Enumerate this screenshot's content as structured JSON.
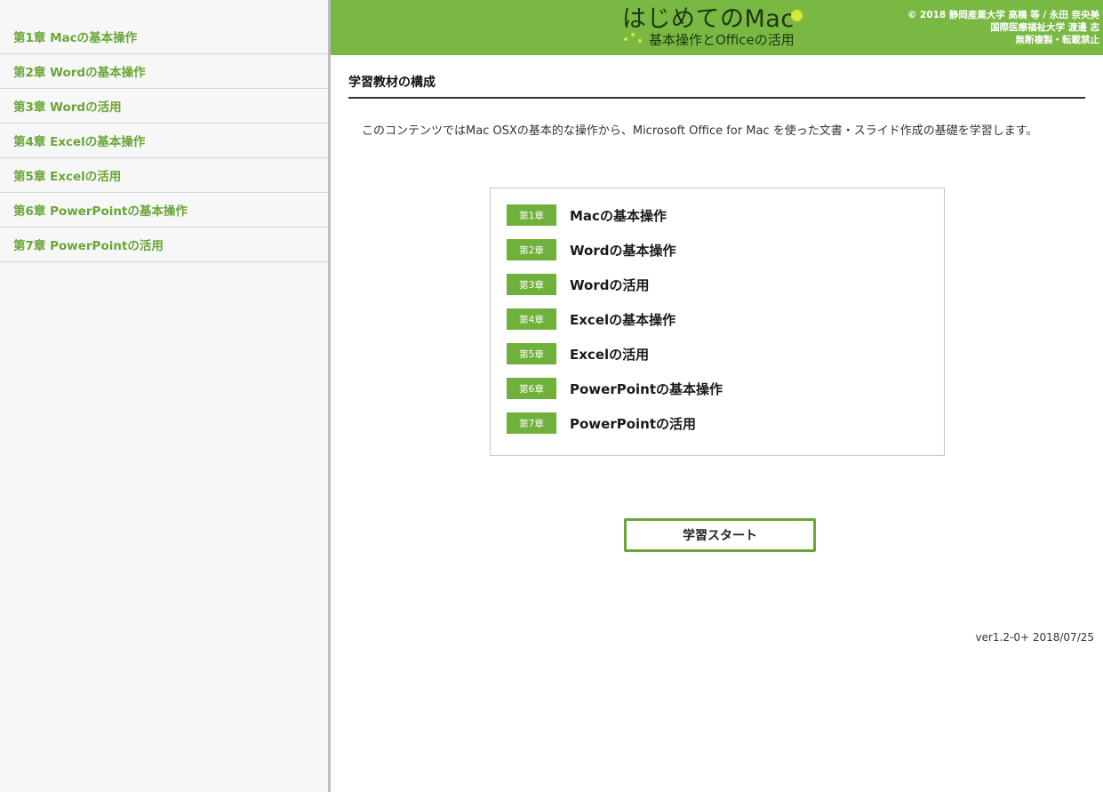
{
  "sidebar": {
    "items": [
      {
        "label": "第1章 Macの基本操作"
      },
      {
        "label": "第2章 Wordの基本操作"
      },
      {
        "label": "第3章 Wordの活用"
      },
      {
        "label": "第4章 Excelの基本操作"
      },
      {
        "label": "第5章 Excelの活用"
      },
      {
        "label": "第6章 PowerPointの基本操作"
      },
      {
        "label": "第7章 PowerPointの活用"
      }
    ]
  },
  "header": {
    "logo_title": "はじめてのMac",
    "logo_subtitle": "基本操作とOfficeの活用",
    "copyright_lines": [
      "© 2018 静岡産業大学 高橋 等 / 永田 奈央美",
      "国際医療福祉大学 渡邊 志",
      "無断複製・転載禁止"
    ],
    "colors": {
      "background": "#79b943",
      "accent": "#d6e63b",
      "text": "#1f3612"
    }
  },
  "main": {
    "section_title": "学習教材の構成",
    "description": "このコンテンツではMac OSXの基本的な操作から、Microsoft Office for Mac を使った文書・スライド作成の基礎を学習します。",
    "chapters": [
      {
        "badge": "第1章",
        "title": "Macの基本操作"
      },
      {
        "badge": "第2章",
        "title": "Wordの基本操作"
      },
      {
        "badge": "第3章",
        "title": "Wordの活用"
      },
      {
        "badge": "第4章",
        "title": "Excelの基本操作"
      },
      {
        "badge": "第5章",
        "title": "Excelの活用"
      },
      {
        "badge": "第6章",
        "title": "PowerPointの基本操作"
      },
      {
        "badge": "第7章",
        "title": "PowerPointの活用"
      }
    ],
    "start_button_label": "学習スタート",
    "version": "ver1.2-0+ 2018/07/25",
    "colors": {
      "badge": "#6fb13b",
      "sidebar_text": "#6aa637"
    }
  }
}
